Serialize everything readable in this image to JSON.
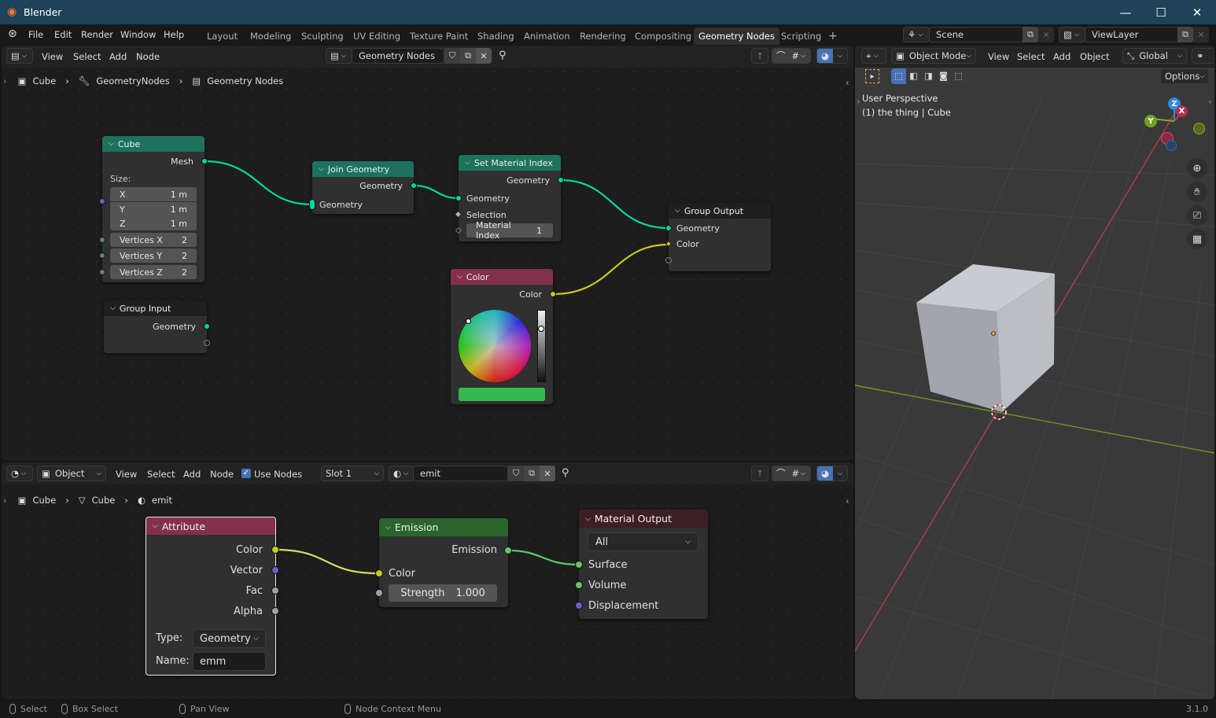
{
  "window": {
    "title": "Blender",
    "minimize": "—",
    "maximize": "☐",
    "close": "✕"
  },
  "menu": {
    "items": [
      "File",
      "Edit",
      "Render",
      "Window",
      "Help"
    ]
  },
  "workspaces": {
    "tabs": [
      "Layout",
      "Modeling",
      "Sculpting",
      "UV Editing",
      "Texture Paint",
      "Shading",
      "Animation",
      "Rendering",
      "Compositing",
      "Geometry Nodes",
      "Scripting"
    ],
    "active": "Geometry Nodes",
    "add": "+"
  },
  "scene": {
    "name": "Scene",
    "view_layer": "ViewLayer"
  },
  "geo_editor": {
    "header": {
      "menus": [
        "View",
        "Select",
        "Add",
        "Node"
      ],
      "node_group": "Geometry Nodes"
    },
    "breadcrumb": [
      "Cube",
      "GeometryNodes",
      "Geometry Nodes"
    ],
    "nodes": {
      "cube": {
        "title": "Cube",
        "output": "Mesh",
        "size_label": "Size:",
        "x_label": "X",
        "x_value": "1 m",
        "y_label": "Y",
        "y_value": "1 m",
        "z_label": "Z",
        "z_value": "1 m",
        "vx_label": "Vertices X",
        "vx_value": "2",
        "vy_label": "Vertices Y",
        "vy_value": "2",
        "vz_label": "Vertices Z",
        "vz_value": "2"
      },
      "group_input": {
        "title": "Group Input",
        "output": "Geometry"
      },
      "join": {
        "title": "Join Geometry",
        "output": "Geometry",
        "input": "Geometry"
      },
      "set_material": {
        "title": "Set Material Index",
        "output": "Geometry",
        "in_geometry": "Geometry",
        "in_selection": "Selection",
        "index_label": "Material Index",
        "index_value": "1"
      },
      "color": {
        "title": "Color",
        "output": "Color",
        "swatch": "#35b94d"
      },
      "group_output": {
        "title": "Group Output",
        "in_geometry": "Geometry",
        "in_color": "Color"
      }
    }
  },
  "shader_editor": {
    "header": {
      "object_mode": "Object",
      "menus": [
        "View",
        "Select",
        "Add",
        "Node"
      ],
      "use_nodes_label": "Use Nodes",
      "use_nodes": true,
      "slot": "Slot 1",
      "material": "emit"
    },
    "breadcrumb": [
      "Cube",
      "Cube",
      "emit"
    ],
    "nodes": {
      "attribute": {
        "title": "Attribute",
        "out_color": "Color",
        "out_vector": "Vector",
        "out_fac": "Fac",
        "out_alpha": "Alpha",
        "type_label": "Type:",
        "type_value": "Geometry",
        "name_label": "Name:",
        "name_value": "emm"
      },
      "emission": {
        "title": "Emission",
        "output": "Emission",
        "in_color": "Color",
        "strength_label": "Strength",
        "strength_value": "1.000"
      },
      "material_output": {
        "title": "Material Output",
        "target": "All",
        "in_surface": "Surface",
        "in_volume": "Volume",
        "in_displacement": "Displacement"
      }
    }
  },
  "viewport": {
    "header": {
      "mode": "Object Mode",
      "menus": [
        "View",
        "Select",
        "Add",
        "Object"
      ],
      "orientation": "Global",
      "options": "Options"
    },
    "overlay_text": {
      "perspective": "User Perspective",
      "object": "(1) the thing | Cube"
    },
    "gizmo": {
      "z": "Z",
      "x": "X",
      "y": "Y"
    }
  },
  "statusbar": {
    "select": "Select",
    "box_select": "Box Select",
    "pan_view": "Pan View",
    "context_menu": "Node Context Menu",
    "version": "3.1.0"
  },
  "colors": {
    "geometry_socket": "#00d6a3",
    "color_socket": "#c7c729",
    "shader_socket": "#63c763",
    "vector_socket": "#6363c7",
    "float_socket": "#a1a1a1",
    "int_socket": "#598c5c",
    "bool_socket": "#cca6d6",
    "geo_header": "#1d725e",
    "color_header": "#83314a",
    "shader_header": "#2b652b",
    "output_header": "#3b1f25",
    "title_bar": "#1e4259"
  }
}
